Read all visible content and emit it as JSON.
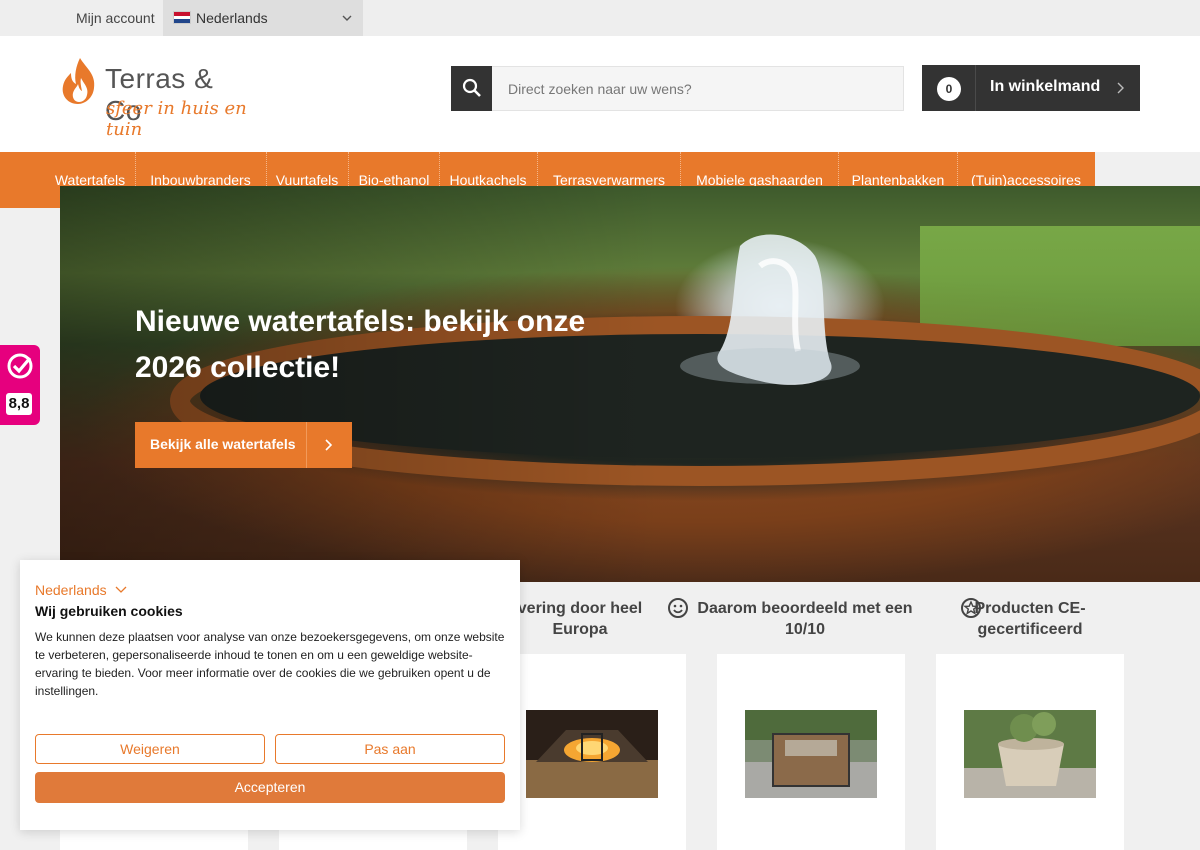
{
  "topbar": {
    "account_label": "Mijn account",
    "language_label": "Nederlands"
  },
  "header": {
    "logo": {
      "brand": "Terras",
      "amp": "& Co",
      "tagline": "sfeer in huis en tuin"
    },
    "search": {
      "placeholder": "Direct zoeken naar uw wens?",
      "value": ""
    },
    "cart": {
      "count": "0",
      "label": "In winkelmand"
    }
  },
  "nav": {
    "items": [
      {
        "label": "Watertafels"
      },
      {
        "label": "Inbouwbranders"
      },
      {
        "label": "Vuurtafels"
      },
      {
        "label": "Bio-ethanol"
      },
      {
        "label": "Houtkachels"
      },
      {
        "label": "Terrasverwarmers"
      },
      {
        "label": "Mobiele gashaarden"
      },
      {
        "label": "Plantenbakken"
      },
      {
        "label": "(Tuin)accessoires"
      }
    ]
  },
  "hero": {
    "title": "Nieuwe watertafels: bekijk onze 2026 collectie!",
    "cta_label": "Bekijk alle watertafels"
  },
  "review_badge": {
    "score": "8,8"
  },
  "usps": [
    {
      "text": "vering door heel Europa",
      "icon": "none"
    },
    {
      "text": "Daarom beoordeeld met een 10/10",
      "icon": "smiley-icon"
    },
    {
      "text": "Producten CE-gecertificeerd",
      "icon": "star-badge-icon"
    }
  ],
  "cookie": {
    "language": "Nederlands",
    "heading": "Wij gebruiken cookies",
    "text": "We kunnen deze plaatsen voor analyse van onze bezoekersgegevens, om onze website te verbeteren, gepersonaliseerde inhoud te tonen en om u een geweldige website-ervaring te bieden. Voor meer informatie over de cookies die we gebruiken opent u de instellingen.",
    "reject_label": "Weigeren",
    "customize_label": "Pas aan",
    "accept_label": "Accepteren"
  },
  "colors": {
    "accent": "#e8792b",
    "dark": "#333333",
    "badge": "#e6007e"
  }
}
